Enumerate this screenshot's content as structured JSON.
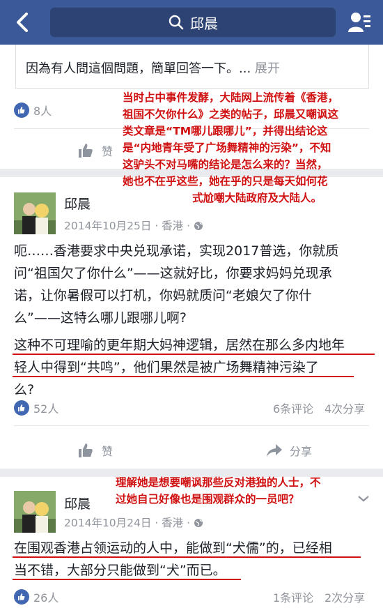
{
  "search": {
    "query": "邱晨"
  },
  "post0": {
    "text": "因為有人問這個問題，簡單回答一下。...",
    "expand": "展开",
    "likes": "8人",
    "like_label": "赞"
  },
  "annotation1": [
    "当时占中事件发酵，大陆网上流传着《香港，",
    "祖国不欠你什么》之类的帖子，邱晨又嘲讽这",
    "类文章是“TM哪儿跟哪儿”，并得出结论这",
    "是“内地青年受了广场舞精神的污染”，不知",
    "这驴头不对马嘴的结论是怎么来的？当然，",
    "她也不在乎这些，她在乎的只是每天如何花",
    "式尬嘲大陆政府及大陆人。"
  ],
  "post1": {
    "author": "邱晨",
    "date": "2014年10月25日 · 香港 ·",
    "paragraph1": [
      "呃……香港要求中央兑现承诺，实现2017普选，你就质",
      "问“祖国欠了你什么”——这就好比，你要求妈妈兑现承",
      "诺，让你暑假可以打机，你妈就质问“老娘欠了你什",
      "么”——这特么哪儿跟哪儿啊?"
    ],
    "paragraph2": [
      "这种不可理喻的更年期大妈神逻辑，居然在那么多内地年",
      "轻人中得到“共鸣”，他们果然是被广场舞精神污染了",
      "么?"
    ],
    "likes": "52人",
    "comments": "6条评论",
    "shares": "4次分享",
    "like_label": "赞",
    "share_label": "分享"
  },
  "annotation2": [
    "理解她是想要嘲讽那些反对港独的人士，不",
    "过她自己好像也是围观群众的一员吧？"
  ],
  "post2": {
    "author": "邱晨",
    "date": "2014年10月24日 · 香港 ·",
    "paragraph": [
      "在围观香港占领运动的人中，能做到“犬儒”的，已经相",
      "当不错，大部分只能做到“犬”而已。"
    ],
    "likes": "26人",
    "comments": "1条评论",
    "shares": "2次分享"
  },
  "colors": {
    "brand": "#3b5998",
    "annotation": "#d01010",
    "like_blue": "#4267b2"
  }
}
